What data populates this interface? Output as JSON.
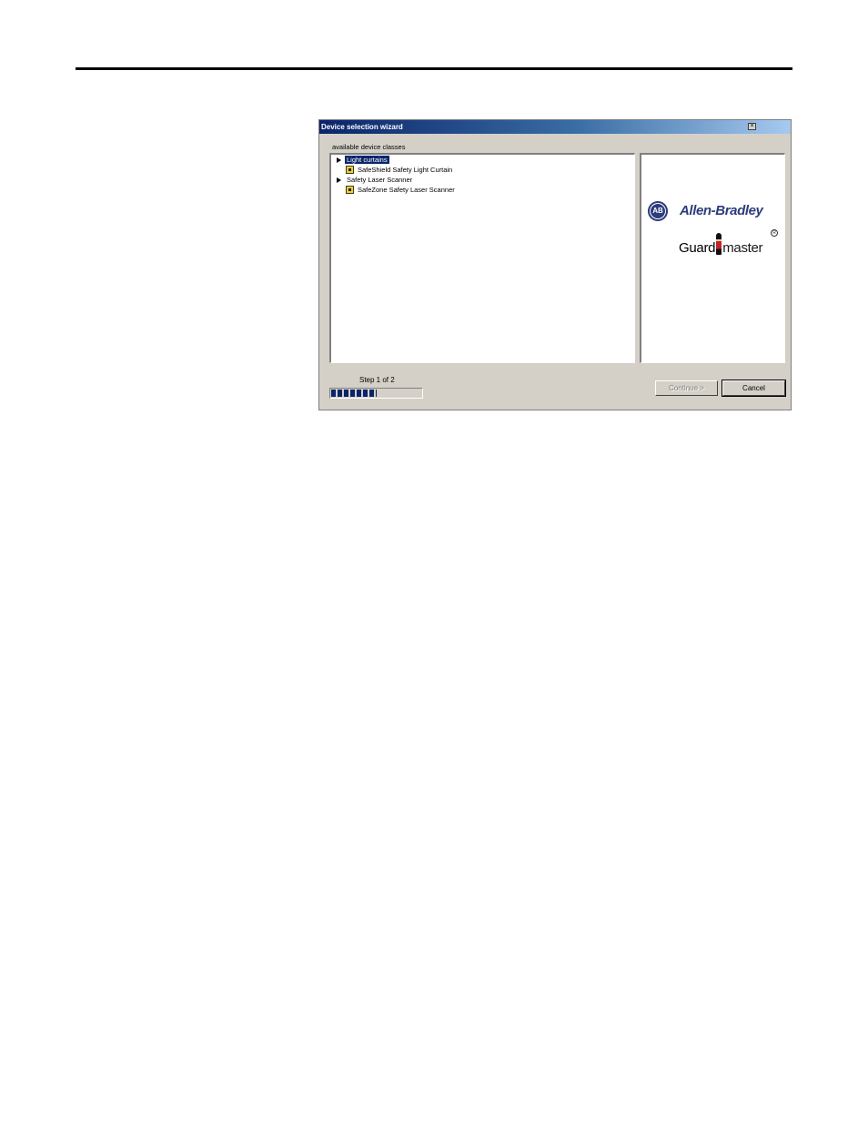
{
  "window": {
    "title": "Device selection wizard",
    "close_glyph": "×"
  },
  "device_classes": {
    "label": "available device classes",
    "groups": [
      {
        "label": "Light curtains",
        "selected": true,
        "expander_icon": "triangle-right-icon",
        "devices": [
          {
            "label": "SafeShield Safety Light Curtain",
            "icon": "light-curtain-icon"
          }
        ]
      },
      {
        "label": "Safety Laser Scanner",
        "selected": false,
        "expander_icon": "triangle-right-icon",
        "devices": [
          {
            "label": "SafeZone Safety Laser Scanner",
            "icon": "laser-scanner-icon"
          }
        ]
      }
    ]
  },
  "logo": {
    "badge": "AB",
    "brand": "Allen-Bradley",
    "product_prefix": "Guard",
    "product_suffix": "master",
    "registered_mark": "R",
    "brand_color": "#2d3c7c"
  },
  "footer": {
    "step_label": "Step 1 of 2",
    "progress": 0.5,
    "continue_label": "Continue >",
    "cancel_label": "Cancel"
  },
  "colors": {
    "selection": "#0a246a",
    "dialog_bg": "#d4d0c8",
    "titlebar_start": "#0a246a",
    "titlebar_end": "#a6caf0"
  }
}
